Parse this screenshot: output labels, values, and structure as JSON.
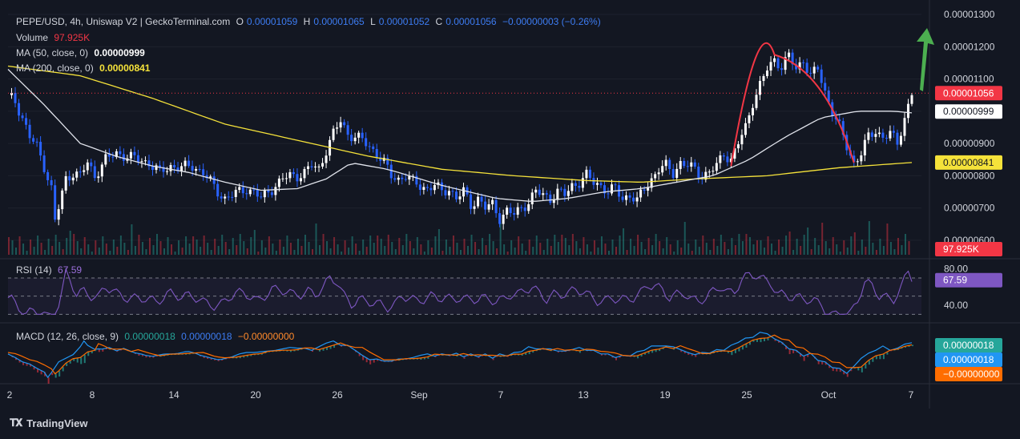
{
  "header": {
    "symbol": "PEPE/USD, 4h, Uniswap V2 | GeckoTerminal.com",
    "o_label": "O",
    "o_value": "0.00001059",
    "h_label": "H",
    "h_value": "0.00001065",
    "l_label": "L",
    "l_value": "0.00001052",
    "c_label": "C",
    "c_value": "0.00001056",
    "change": "−0.00000003 (−0.26%)"
  },
  "volume": {
    "label": "Volume",
    "value": "97.925K"
  },
  "ma50": {
    "label": "MA (50, close, 0)",
    "value": "0.00000999"
  },
  "ma200": {
    "label": "MA (200, close, 0)",
    "value": "0.00000841"
  },
  "rsi": {
    "label": "RSI (14)",
    "value": "67.59"
  },
  "macd": {
    "label": "MACD (12, 26, close, 9)",
    "v1": "0.00000018",
    "v2": "0.00000018",
    "v3": "−0.00000000"
  },
  "branding": {
    "name": "TradingView"
  },
  "colors": {
    "bg": "#131722",
    "up": "#ffffff",
    "down": "#2962ff",
    "ma50": "#e0e3eb",
    "ma200": "#f5e23a",
    "rsi": "#7e57c2",
    "macd": "#2196f3",
    "signal": "#ff6d00",
    "arrow": "#4caf50",
    "arc": "#f23645"
  },
  "chart_data": [
    {
      "type": "candlestick",
      "panel": "price",
      "x_ticks": [
        "2",
        "8",
        "14",
        "20",
        "26",
        "Sep",
        "7",
        "13",
        "19",
        "25",
        "Oct",
        "7"
      ],
      "y_ticks": [
        "0.00001300",
        "0.00001200",
        "0.00001100",
        "0.00001000",
        "0.00000900",
        "0.00000800",
        "0.00000700",
        "0.00000600"
      ],
      "ylim": [
        5.6e-06,
        1.32e-05
      ],
      "price_points": [
        [
          0,
          10.5
        ],
        [
          2,
          10.3
        ],
        [
          4,
          9.8
        ],
        [
          6,
          9.2
        ],
        [
          8,
          8.9
        ],
        [
          10,
          8.3
        ],
        [
          12,
          7.6
        ],
        [
          13,
          6.6
        ],
        [
          14,
          7.0
        ],
        [
          16,
          7.9
        ],
        [
          18,
          8.1
        ],
        [
          20,
          8.0
        ],
        [
          22,
          8.4
        ],
        [
          24,
          8.0
        ],
        [
          27,
          8.5
        ],
        [
          30,
          8.7
        ],
        [
          33,
          8.6
        ],
        [
          36,
          8.5
        ],
        [
          39,
          8.4
        ],
        [
          42,
          8.1
        ],
        [
          45,
          8.3
        ],
        [
          48,
          8.25
        ],
        [
          51,
          8.3
        ],
        [
          54,
          8.1
        ],
        [
          56,
          7.8
        ],
        [
          58,
          7.5
        ],
        [
          60,
          7.3
        ],
        [
          62,
          7.4
        ],
        [
          64,
          7.5
        ],
        [
          66,
          7.6
        ],
        [
          68,
          7.5
        ],
        [
          70,
          7.3
        ],
        [
          72,
          7.5
        ],
        [
          74,
          7.7
        ],
        [
          76,
          7.9
        ],
        [
          78,
          8.0
        ],
        [
          80,
          8.0
        ],
        [
          82,
          8.1
        ],
        [
          84,
          8.3
        ],
        [
          86,
          8.2
        ],
        [
          88,
          8.8
        ],
        [
          90,
          9.3
        ],
        [
          92,
          9.7
        ],
        [
          94,
          9.3
        ],
        [
          96,
          9.2
        ],
        [
          98,
          9.1
        ],
        [
          100,
          8.9
        ],
        [
          102,
          8.7
        ],
        [
          104,
          8.4
        ],
        [
          106,
          8.0
        ],
        [
          108,
          7.9
        ],
        [
          110,
          8.0
        ],
        [
          112,
          7.8
        ],
        [
          114,
          7.7
        ],
        [
          116,
          7.6
        ],
        [
          118,
          7.7
        ],
        [
          120,
          7.5
        ],
        [
          122,
          7.6
        ],
        [
          124,
          7.3
        ],
        [
          126,
          7.5
        ],
        [
          128,
          7.1
        ],
        [
          130,
          7.3
        ],
        [
          132,
          7.0
        ],
        [
          134,
          7.1
        ],
        [
          136,
          6.7
        ],
        [
          138,
          6.9
        ],
        [
          140,
          6.8
        ],
        [
          142,
          7.0
        ],
        [
          144,
          7.2
        ],
        [
          146,
          7.5
        ],
        [
          148,
          7.4
        ],
        [
          150,
          7.3
        ],
        [
          152,
          7.5
        ],
        [
          154,
          7.4
        ],
        [
          156,
          7.7
        ],
        [
          158,
          7.8
        ],
        [
          160,
          8.0
        ],
        [
          162,
          7.8
        ],
        [
          164,
          7.7
        ],
        [
          166,
          7.5
        ],
        [
          168,
          7.6
        ],
        [
          170,
          7.3
        ],
        [
          172,
          7.4
        ],
        [
          174,
          7.2
        ],
        [
          176,
          7.6
        ],
        [
          178,
          7.9
        ],
        [
          180,
          8.2
        ],
        [
          182,
          8.3
        ],
        [
          184,
          8.1
        ],
        [
          186,
          8.4
        ],
        [
          188,
          8.3
        ],
        [
          190,
          8.2
        ],
        [
          192,
          8.0
        ],
        [
          194,
          8.1
        ],
        [
          196,
          8.3
        ],
        [
          198,
          8.7
        ],
        [
          200,
          8.5
        ],
        [
          202,
          9.0
        ],
        [
          204,
          9.5
        ],
        [
          206,
          10.3
        ],
        [
          208,
          10.8
        ],
        [
          210,
          11.3
        ],
        [
          212,
          11.6
        ],
        [
          214,
          11.4
        ],
        [
          216,
          11.7
        ],
        [
          218,
          11.3
        ],
        [
          220,
          11.6
        ],
        [
          222,
          11.1
        ],
        [
          224,
          11.3
        ],
        [
          226,
          10.6
        ],
        [
          228,
          10.0
        ],
        [
          230,
          9.5
        ],
        [
          232,
          8.9
        ],
        [
          234,
          8.4
        ],
        [
          236,
          8.7
        ],
        [
          238,
          9.2
        ],
        [
          240,
          9.4
        ],
        [
          242,
          9.2
        ],
        [
          244,
          9.3
        ],
        [
          246,
          9.0
        ],
        [
          248,
          9.8
        ],
        [
          250,
          10.56
        ]
      ],
      "ma50_points": [
        [
          0,
          11.3
        ],
        [
          10,
          10.2
        ],
        [
          20,
          9.0
        ],
        [
          30,
          8.6
        ],
        [
          40,
          8.3
        ],
        [
          50,
          8.1
        ],
        [
          60,
          7.8
        ],
        [
          70,
          7.55
        ],
        [
          80,
          7.6
        ],
        [
          88,
          7.9
        ],
        [
          95,
          8.4
        ],
        [
          105,
          8.2
        ],
        [
          120,
          7.7
        ],
        [
          135,
          7.3
        ],
        [
          145,
          7.2
        ],
        [
          155,
          7.3
        ],
        [
          165,
          7.5
        ],
        [
          175,
          7.6
        ],
        [
          185,
          7.8
        ],
        [
          195,
          8.0
        ],
        [
          205,
          8.5
        ],
        [
          215,
          9.2
        ],
        [
          225,
          9.8
        ],
        [
          235,
          10.0
        ],
        [
          245,
          10.0
        ],
        [
          250,
          9.95
        ]
      ],
      "ma200_points": [
        [
          0,
          11.4
        ],
        [
          20,
          11.1
        ],
        [
          40,
          10.4
        ],
        [
          60,
          9.6
        ],
        [
          80,
          9.1
        ],
        [
          100,
          8.6
        ],
        [
          120,
          8.2
        ],
        [
          140,
          8.0
        ],
        [
          160,
          7.85
        ],
        [
          175,
          7.8
        ],
        [
          190,
          7.9
        ],
        [
          210,
          8.0
        ],
        [
          230,
          8.25
        ],
        [
          250,
          8.41
        ]
      ],
      "volume_label": "97.925K"
    },
    {
      "type": "line",
      "panel": "rsi",
      "name": "RSI (14)",
      "y_ticks": [
        "80.00",
        "40.00"
      ],
      "ylim": [
        25,
        85
      ],
      "bands": [
        70,
        50,
        30
      ],
      "last_value": 67.59
    },
    {
      "type": "line",
      "panel": "macd",
      "name": "MACD (12, 26, close, 9)",
      "last_values": [
        "0.00000018",
        "0.00000018",
        "−0.00000000"
      ]
    }
  ],
  "price_tags": {
    "last": "0.00001056",
    "ma50": "0.00000999",
    "ma200": "0.00000841",
    "volume": "97.925K",
    "rsi": "67.59",
    "macd1": "0.00000018",
    "macd2": "0.00000018",
    "macd3": "−0.00000000"
  }
}
